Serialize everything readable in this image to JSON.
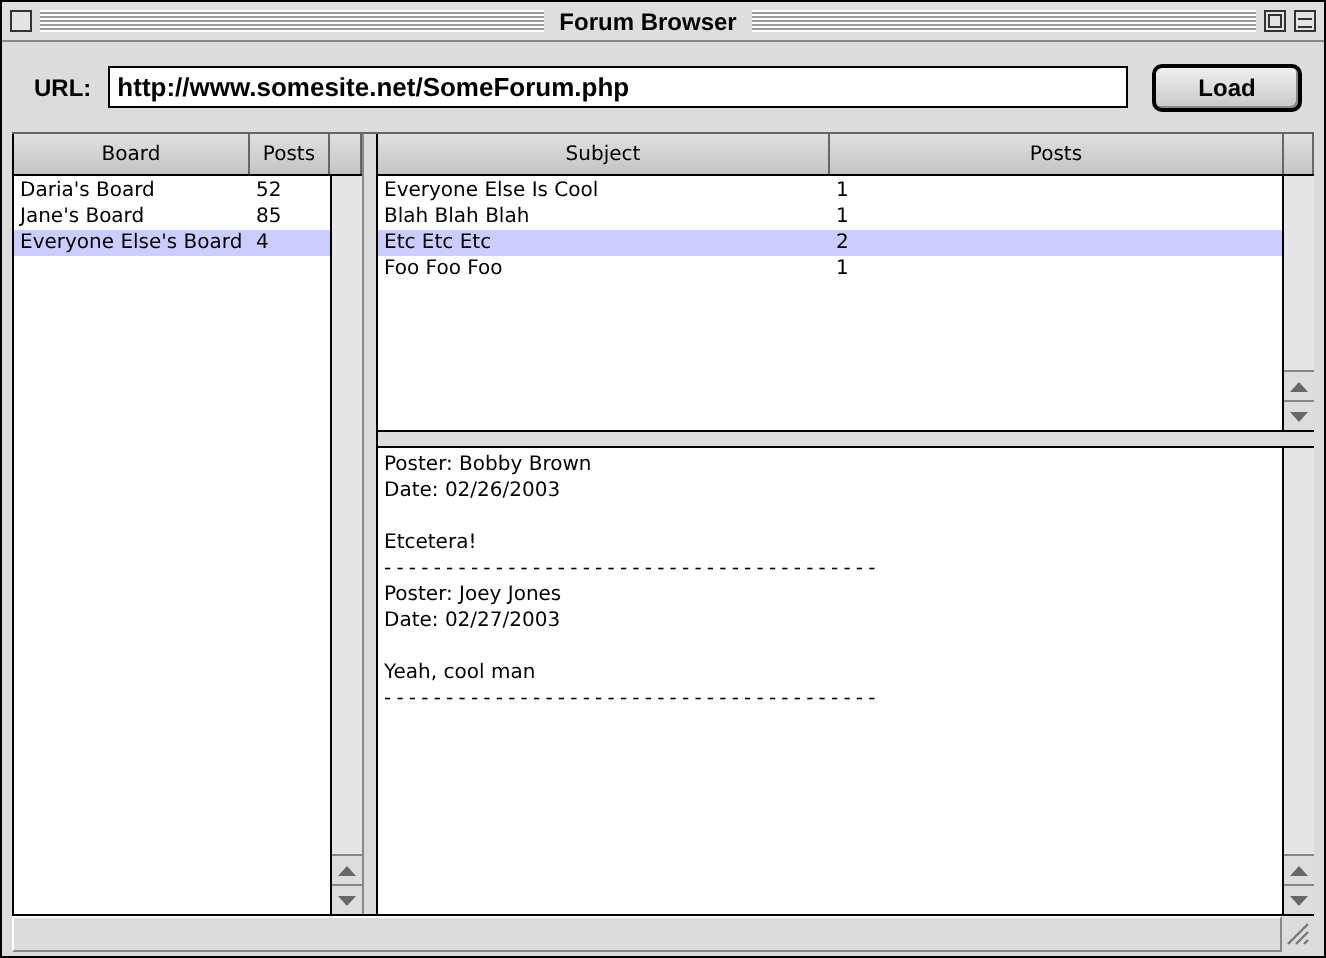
{
  "window": {
    "title": "Forum Browser"
  },
  "url_bar": {
    "label": "URL:",
    "value": "http://www.somesite.net/SomeForum.php",
    "button": "Load"
  },
  "boards": {
    "columns": [
      "Board",
      "Posts"
    ],
    "rows": [
      {
        "name": "Daria's Board",
        "posts": "52",
        "selected": false
      },
      {
        "name": "Jane's Board",
        "posts": "85",
        "selected": false
      },
      {
        "name": "Everyone Else's Board",
        "posts": "4",
        "selected": true
      }
    ]
  },
  "threads": {
    "columns": [
      "Subject",
      "Posts"
    ],
    "rows": [
      {
        "subject": "Everyone Else Is Cool",
        "posts": "1",
        "selected": false
      },
      {
        "subject": "Blah Blah Blah",
        "posts": "1",
        "selected": false
      },
      {
        "subject": "Etc Etc Etc",
        "posts": "2",
        "selected": true
      },
      {
        "subject": "Foo Foo Foo",
        "posts": "1",
        "selected": false
      }
    ]
  },
  "messages": [
    {
      "poster": "Poster: Bobby Brown",
      "date": "Date: 02/26/2003",
      "body": "Etcetera!",
      "separator": "----------------------------------------"
    },
    {
      "poster": "Poster: Joey Jones",
      "date": "Date: 02/27/2003",
      "body": "Yeah, cool man",
      "separator": "----------------------------------------"
    }
  ]
}
